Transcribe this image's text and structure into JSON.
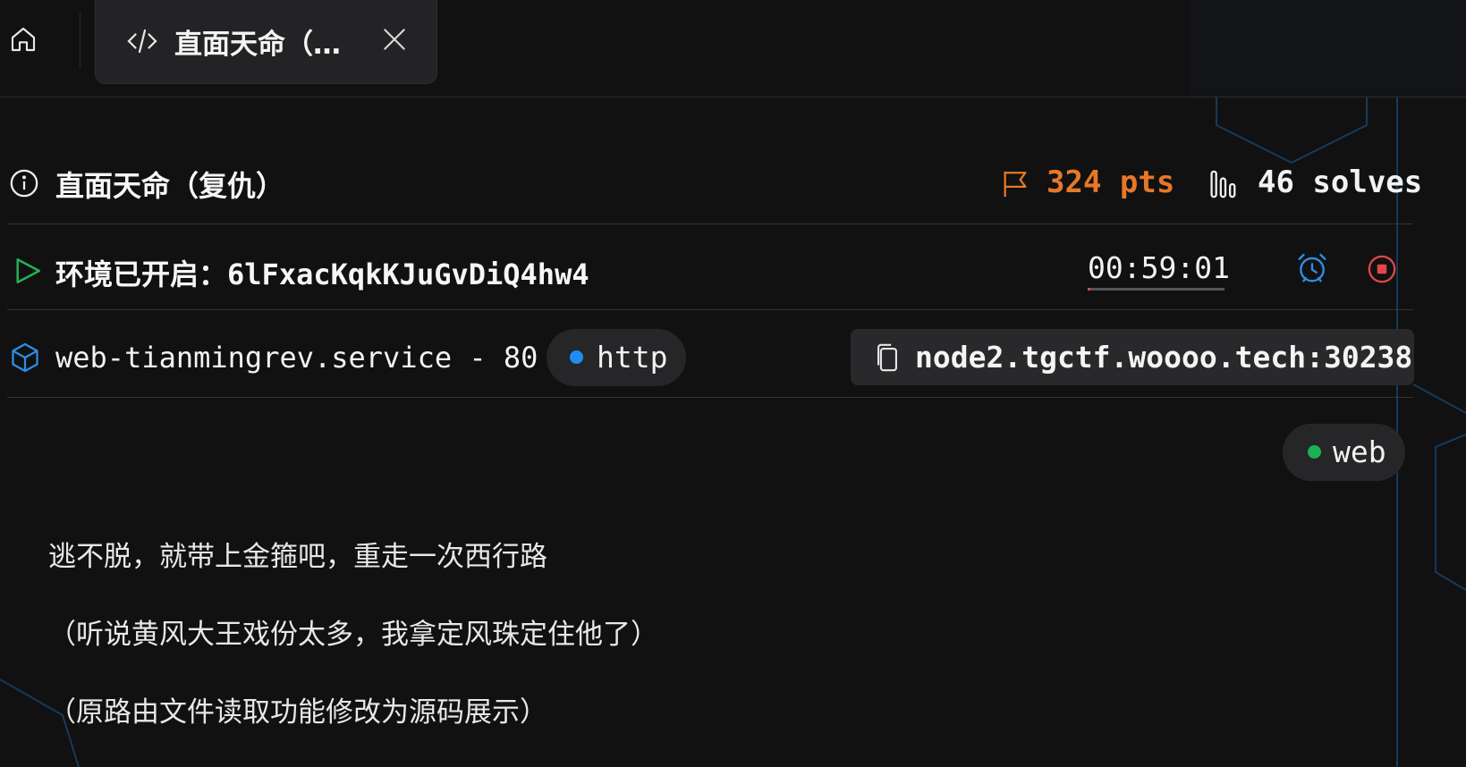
{
  "tab": {
    "title": "直面天命（…",
    "home_icon": "home-icon",
    "code_icon": "code-icon",
    "close_icon": "close-icon"
  },
  "challenge": {
    "title": "直面天命（复仇）",
    "points": "324 pts",
    "solves": "46 solves"
  },
  "environment": {
    "label": "环境已开启：",
    "id": "6lFxacKqkKJuGvDiQ4hw4",
    "timer": "00:59:01",
    "timer_remaining_fraction": 0.02
  },
  "service": {
    "name": "web-tianmingrev.service - 80",
    "protocol": "http",
    "address": "node2.tgctf.woooo.tech:30238"
  },
  "tag": "web",
  "description": [
    "逃不脱，就带上金箍吧，重走一次西行路",
    "（听说黄风大王戏份太多，我拿定风珠定住他了）",
    "（原路由文件读取功能修改为源码展示）"
  ],
  "colors": {
    "background": "#111111",
    "points": "#e67829",
    "http_dot": "#1e8ff0",
    "tag_dot": "#19b152",
    "play": "#22b357",
    "alarm": "#2e8ee6",
    "stop": "#e04848",
    "cube": "#2e8ee6"
  }
}
